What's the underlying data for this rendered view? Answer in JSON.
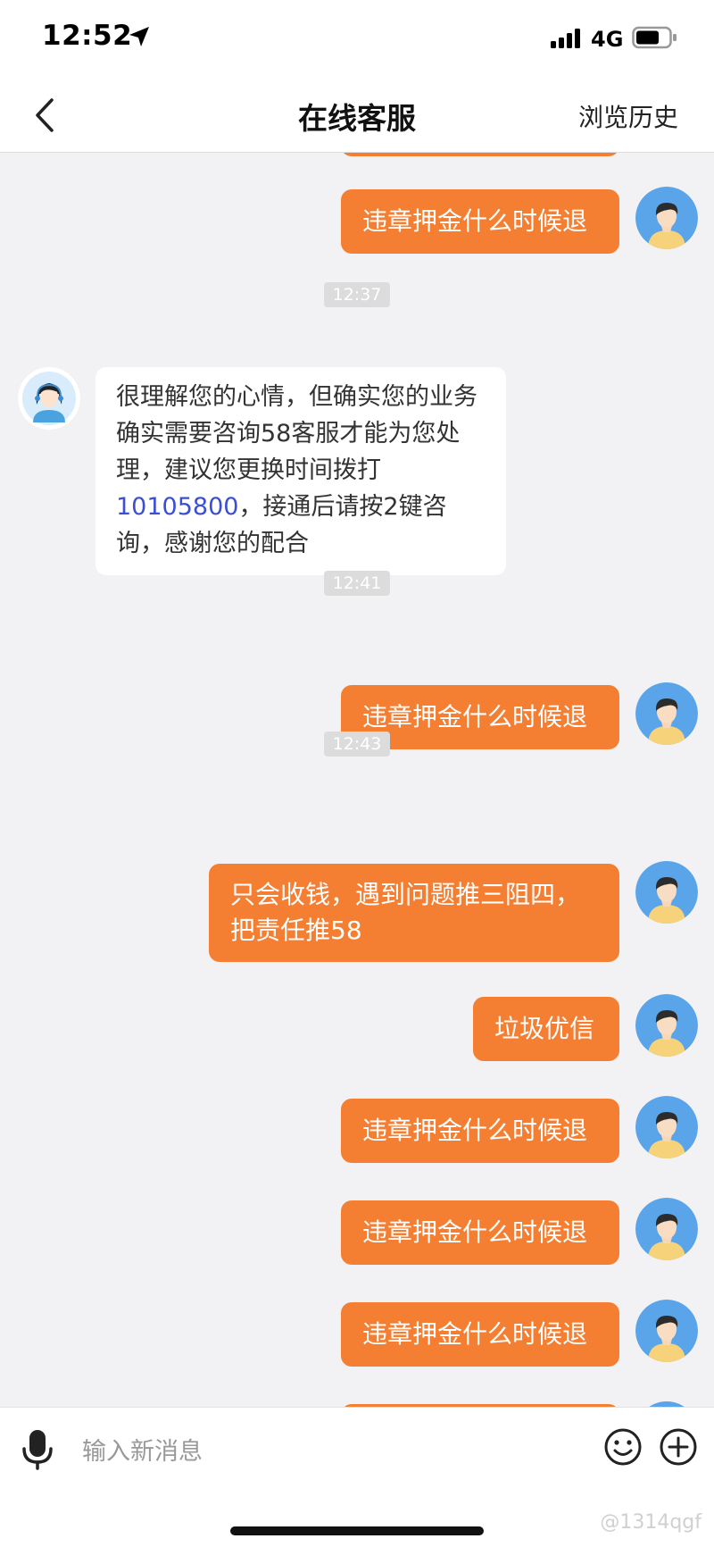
{
  "status": {
    "time": "12:52",
    "network": "4G"
  },
  "nav": {
    "title": "在线客服",
    "right": "浏览历史"
  },
  "timestamps": [
    "12:37",
    "12:41",
    "12:43"
  ],
  "messages": {
    "m1": "违章押金什么时候退",
    "agent_pre": "很理解您的心情，但确实您的业务确实需要咨询58客服才能为您处理，建议您更换时间拨打",
    "agent_phone": "10105800",
    "agent_post": "，接通后请按2键咨询，感谢您的配合",
    "m2": "违章押金什么时候退",
    "m3": "只会收钱，遇到问题推三阻四，把责任推58",
    "m4": "垃圾优信",
    "m5": "违章押金什么时候退",
    "m6": "违章押金什么时候退",
    "m7": "违章押金什么时候退"
  },
  "input": {
    "placeholder": "输入新消息"
  },
  "watermark": "@1314qgf",
  "colors": {
    "accent": "#f47f32",
    "link": "#3a4fd4",
    "background": "#f2f2f4"
  }
}
